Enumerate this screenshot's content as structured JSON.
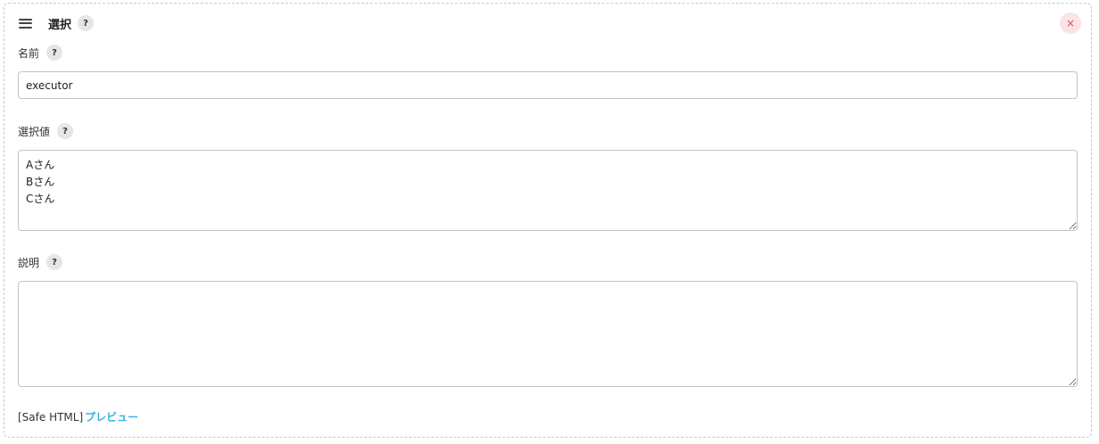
{
  "header": {
    "title": "選択",
    "help": "?",
    "close": "×"
  },
  "fields": {
    "name": {
      "label": "名前",
      "help": "?",
      "value": "executor"
    },
    "choices": {
      "label": "選択値",
      "help": "?",
      "value": "Aさん\nBさん\nCさん"
    },
    "description": {
      "label": "説明",
      "help": "?",
      "value": ""
    }
  },
  "footer": {
    "safe_html": "[Safe HTML]",
    "preview": "プレビュー"
  },
  "colors": {
    "link": "#3bb3e0",
    "close_bg": "#fbe3e6",
    "close_fg": "#d9534f",
    "border": "#b9c6cc"
  }
}
